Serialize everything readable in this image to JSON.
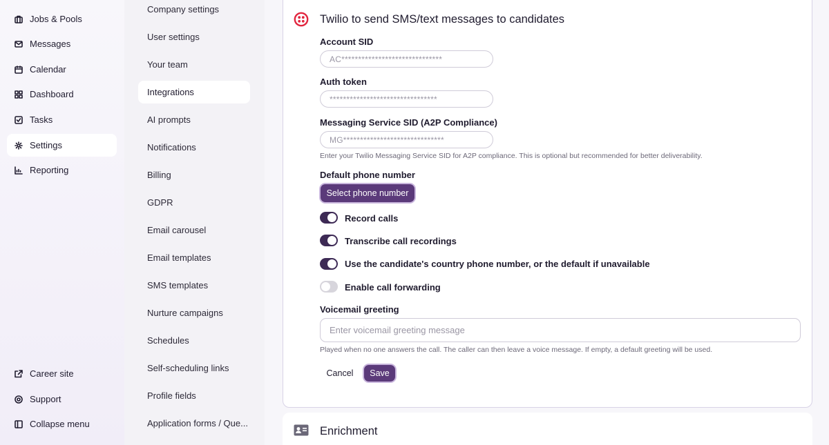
{
  "nav": {
    "items": [
      {
        "label": "Jobs & Pools",
        "icon": "briefcase-icon"
      },
      {
        "label": "Messages",
        "icon": "envelope-icon"
      },
      {
        "label": "Calendar",
        "icon": "calendar-icon"
      },
      {
        "label": "Dashboard",
        "icon": "dashboard-grid-icon"
      },
      {
        "label": "Tasks",
        "icon": "checkbox-icon"
      },
      {
        "label": "Settings",
        "icon": "gear-icon",
        "active": true
      },
      {
        "label": "Reporting",
        "icon": "chart-icon"
      }
    ],
    "bottom": [
      {
        "label": "Career site",
        "icon": "external-link-icon"
      },
      {
        "label": "Support",
        "icon": "help-circle-icon"
      },
      {
        "label": "Collapse menu",
        "icon": "collapse-sidebar-icon"
      }
    ]
  },
  "settings_menu": {
    "items": [
      "Company settings",
      "User settings",
      "Your team",
      "Integrations",
      "AI prompts",
      "Notifications",
      "Billing",
      "GDPR",
      "Email carousel",
      "Email templates",
      "SMS templates",
      "Nurture campaigns",
      "Schedules",
      "Self-scheduling links",
      "Profile fields",
      "Application forms / Que..."
    ],
    "active": "Integrations"
  },
  "twilio": {
    "title": "Twilio to send SMS/text messages to candidates",
    "account_sid_label": "Account SID",
    "account_sid_value": "AC******************************",
    "auth_token_label": "Auth token",
    "auth_token_value": "********************************",
    "messaging_sid_label": "Messaging Service SID (A2P Compliance)",
    "messaging_sid_value": "MG******************************",
    "messaging_sid_hint": "Enter your Twilio Messaging Service SID for A2P compliance. This is optional but recommended for better deliverability.",
    "default_phone_label": "Default phone number",
    "select_phone_button": "Select phone number",
    "toggles": [
      {
        "label": "Record calls",
        "on": true
      },
      {
        "label": "Transcribe call recordings",
        "on": true
      },
      {
        "label": "Use the candidate's country phone number, or the default if unavailable",
        "on": true
      },
      {
        "label": "Enable call forwarding",
        "on": false
      }
    ],
    "voicemail_label": "Voicemail greeting",
    "voicemail_placeholder": "Enter voicemail greeting message",
    "voicemail_hint": "Played when no one answers the call. The caller can then leave a voice message. If empty, a default greeting will be used.",
    "cancel_button": "Cancel",
    "save_button": "Save"
  },
  "enrichment": {
    "title": "Enrichment",
    "icon": "id-card-icon"
  },
  "colors": {
    "primary": "#5b3a7a",
    "toggle_on": "#3d2a55",
    "toggle_off": "#d7d5dc",
    "twilio_red": "#e2263f"
  }
}
